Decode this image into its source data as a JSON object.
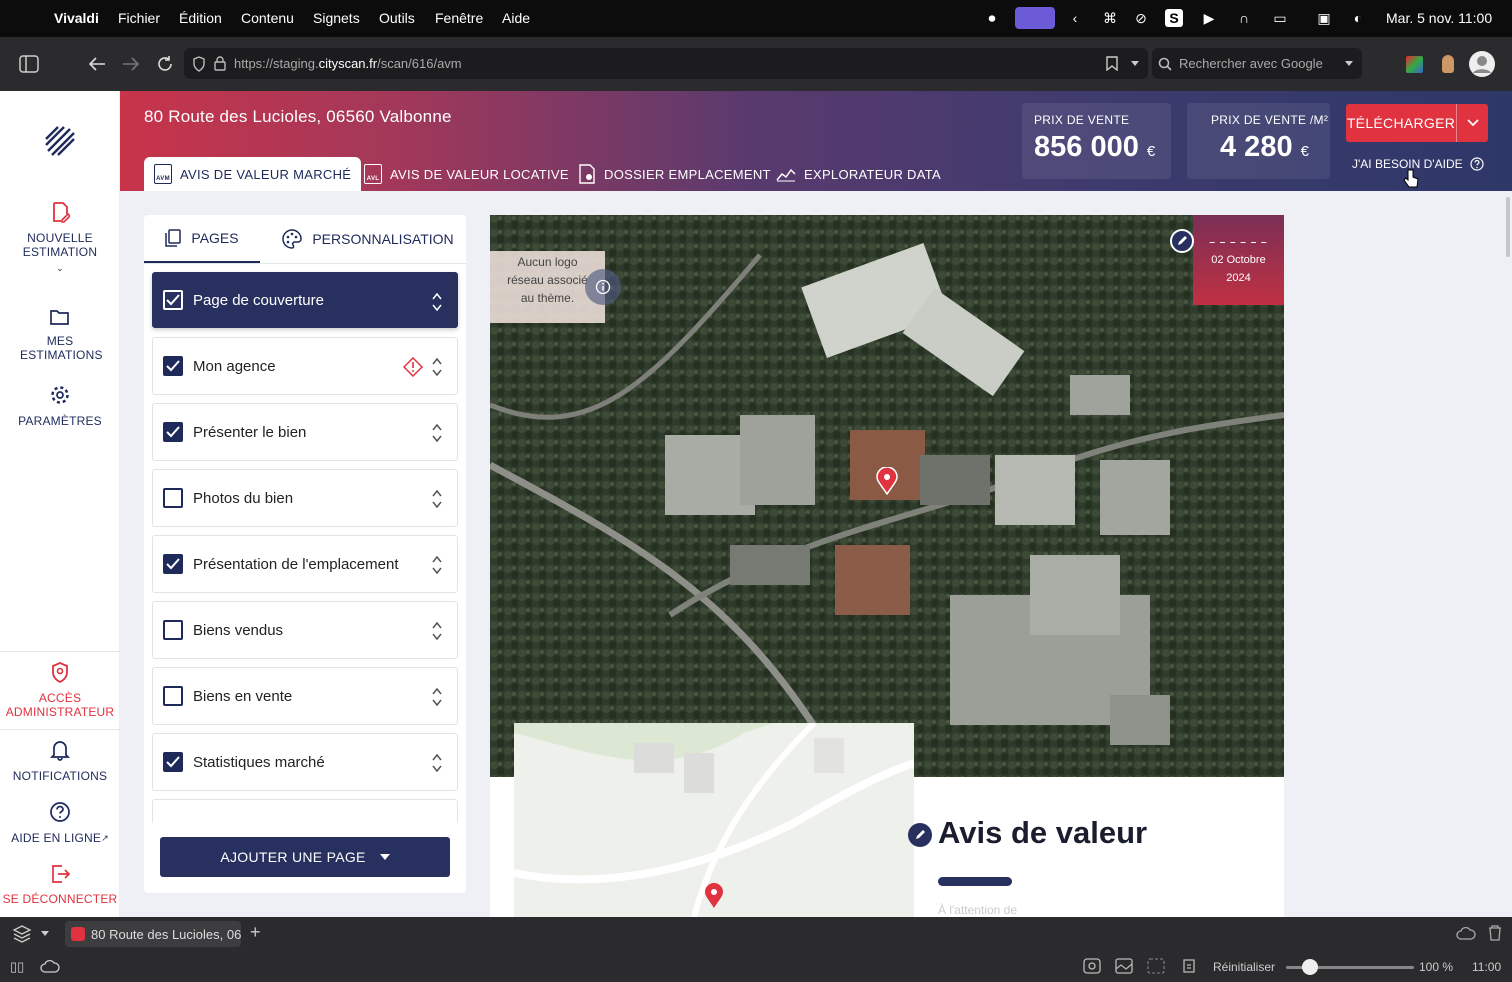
{
  "menubar": {
    "app": "Vivaldi",
    "items": [
      "Fichier",
      "Édition",
      "Contenu",
      "Signets",
      "Outils",
      "Fenêtre",
      "Aide"
    ],
    "clock": "Mar. 5 nov.  11:00"
  },
  "browser": {
    "url_prefix": "https://staging.",
    "url_domain": "cityscan.fr",
    "url_path": "/scan/616/avm",
    "search_placeholder": "Rechercher avec Google"
  },
  "sidebar": {
    "new_estimation": "NOUVELLE ESTIMATION",
    "my_estimations": "MES ESTIMATIONS",
    "settings": "PARAMÈTRES",
    "admin": "ACCÈS ADMINISTRATEUR",
    "notifications": "NOTIFICATIONS",
    "help": "AIDE EN LIGNE",
    "logout": "SE DÉCONNECTER"
  },
  "header": {
    "address": "80 Route des Lucioles, 06560 Valbonne",
    "tabs": [
      {
        "badge": "AVM",
        "label": "AVIS DE VALEUR MARCHÉ"
      },
      {
        "badge": "AVL",
        "label": "AVIS DE VALEUR LOCATIVE"
      },
      {
        "label": "DOSSIER EMPLACEMENT"
      },
      {
        "label": "EXPLORATEUR DATA"
      }
    ],
    "price_label": "PRIX DE VENTE",
    "price_value": "856 000",
    "price_m2_label": "PRIX DE VENTE /M²",
    "price_m2_value": "4 280",
    "currency": "€",
    "download": "TÉLÉCHARGER",
    "need_help": "J'AI BESOIN D'AIDE"
  },
  "panel": {
    "tab_pages": "PAGES",
    "tab_custom": "PERSONNALISATION",
    "items": [
      {
        "label": "Page de couverture",
        "checked": true
      },
      {
        "label": "Mon agence",
        "checked": true
      },
      {
        "label": "Présenter le bien",
        "checked": true
      },
      {
        "label": "Photos du bien",
        "checked": false
      },
      {
        "label": "Présentation de l'emplacement",
        "checked": true
      },
      {
        "label": "Biens vendus",
        "checked": false
      },
      {
        "label": "Biens en vente",
        "checked": false
      },
      {
        "label": "Statistiques marché",
        "checked": true
      }
    ],
    "add_page": "AJOUTER UNE PAGE"
  },
  "preview": {
    "logo_text": "Aucun logo réseau associé au thème.",
    "date_dashes": "– – – – – –",
    "date_line1": "02 Octobre",
    "date_line2": "2024",
    "title": "Avis de valeur",
    "attention": "À l'attention de"
  },
  "tabstrip": {
    "tab_title": "80 Route des Lucioles, 06"
  },
  "statusbar": {
    "reset": "Réinitialiser",
    "zoom": "100 %",
    "time": "11:00"
  },
  "colors": {
    "navy": "#1e2a5a",
    "red": "#e0323f",
    "grad_start": "#c8344a",
    "grad_end": "#2e3868"
  }
}
